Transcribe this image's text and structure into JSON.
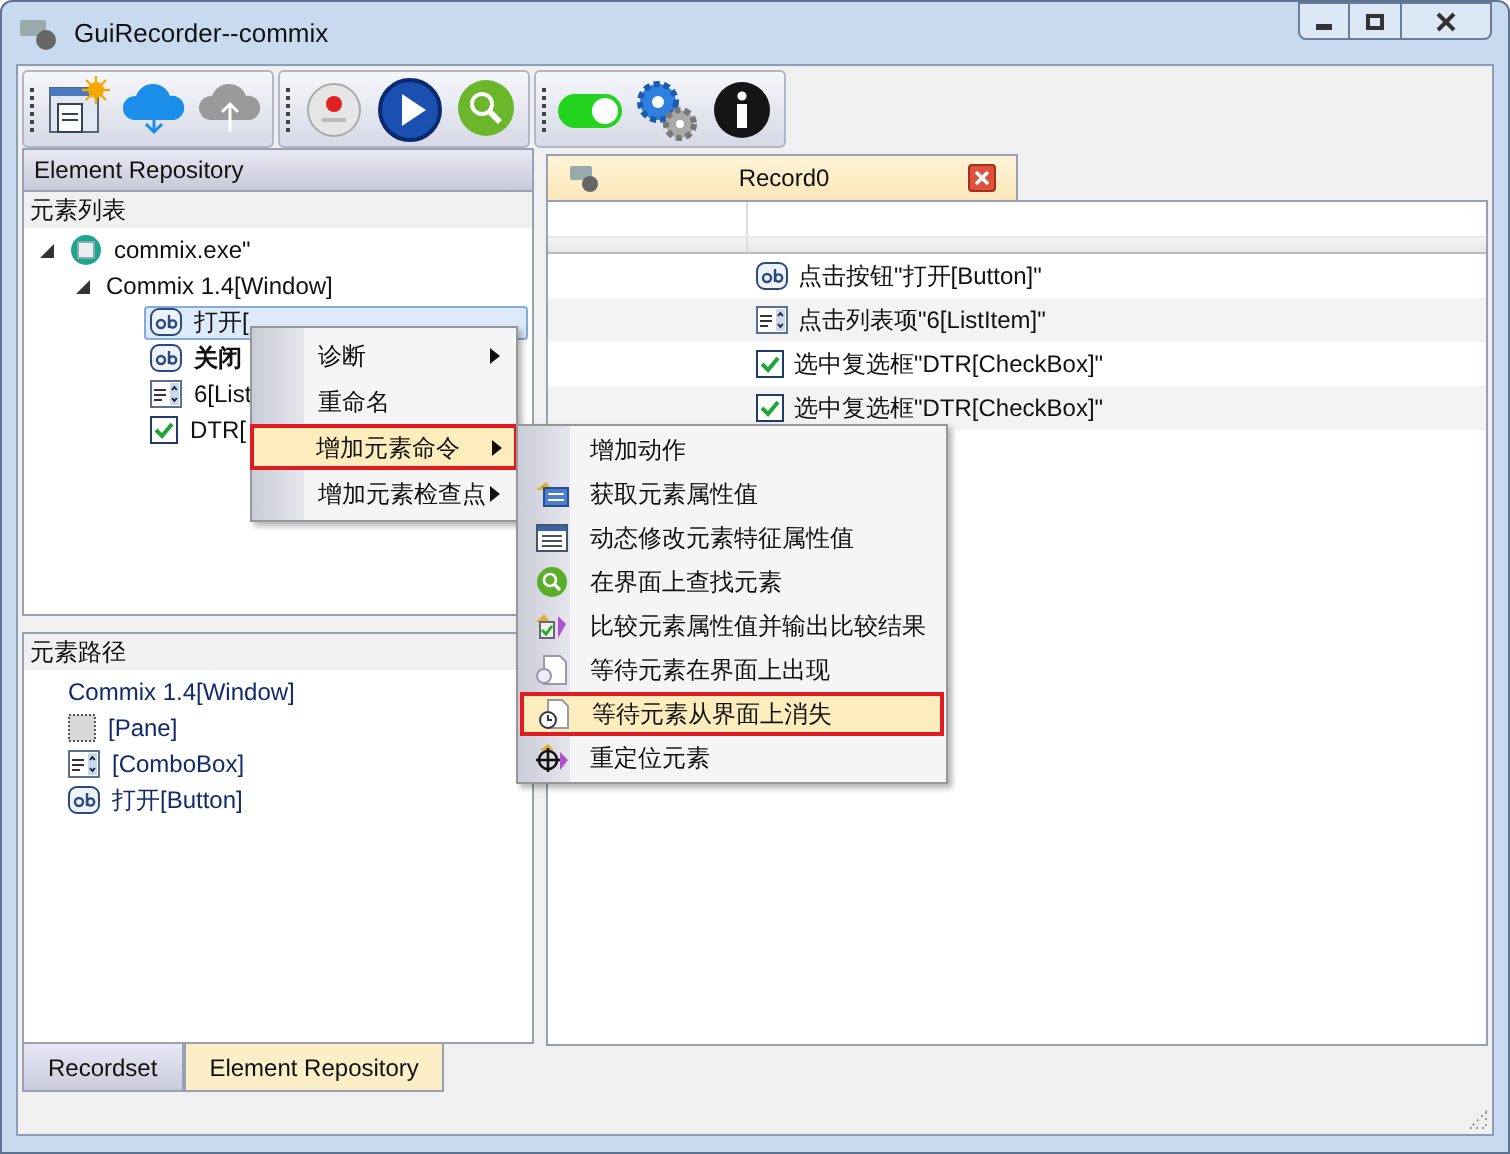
{
  "window": {
    "title": "GuiRecorder--commix"
  },
  "toolbar": [
    [
      {
        "kind": "new-window",
        "disabled": false
      },
      {
        "kind": "download",
        "disabled": false
      },
      {
        "kind": "upload",
        "disabled": true
      }
    ],
    [
      {
        "kind": "record",
        "disabled": false
      },
      {
        "kind": "play",
        "disabled": false
      },
      {
        "kind": "find",
        "disabled": false
      }
    ],
    [
      {
        "kind": "toggle",
        "disabled": false,
        "on": true
      },
      {
        "kind": "settings",
        "disabled": false
      },
      {
        "kind": "info",
        "disabled": false
      }
    ]
  ],
  "left_panel": {
    "title": "Element Repository",
    "element_list": {
      "header": "元素列表",
      "tree": [
        {
          "label": "commix.exe\"",
          "kind": "app",
          "expanded": true,
          "selected": false,
          "bold": false,
          "children": [
            {
              "label": "Commix 1.4[Window]",
              "expanded": true,
              "selected": false,
              "bold": false,
              "children": [
                {
                  "label": "打开[",
                  "kind": "button",
                  "selected": true,
                  "bold": false
                },
                {
                  "label": "关闭",
                  "kind": "button",
                  "selected": false,
                  "bold": true
                },
                {
                  "label": "6[List",
                  "kind": "list",
                  "selected": false,
                  "bold": false
                },
                {
                  "label": "DTR[",
                  "kind": "checkbox",
                  "selected": false,
                  "bold": false
                }
              ]
            }
          ]
        }
      ]
    },
    "element_path": {
      "header": "元素路径",
      "items": [
        {
          "label": "Commix 1.4[Window]"
        },
        {
          "label": "[Pane]",
          "kind": "pane"
        },
        {
          "label": "[ComboBox]",
          "kind": "combobox"
        },
        {
          "label": "打开[Button]",
          "kind": "button"
        }
      ]
    },
    "tabs": [
      {
        "label": "Recordset",
        "selected": false
      },
      {
        "label": "Element Repository",
        "selected": true
      }
    ]
  },
  "record_tab": {
    "title": "Record0",
    "rows": [
      {
        "kind": "button",
        "text": "点击按钮\"打开[Button]\""
      },
      {
        "kind": "list",
        "text": "点击列表项\"6[ListItem]\""
      },
      {
        "kind": "checkbox",
        "text": "选中复选框\"DTR[CheckBox]\""
      },
      {
        "kind": "checkbox",
        "text": "选中复选框\"DTR[CheckBox]\""
      }
    ]
  },
  "context_menu": [
    {
      "label": "诊断",
      "submenu": true,
      "selected": false
    },
    {
      "label": "重命名",
      "submenu": false,
      "selected": false
    },
    {
      "label": "增加元素命令",
      "submenu": true,
      "selected": true
    },
    {
      "label": "增加元素检查点",
      "submenu": true,
      "selected": false
    }
  ],
  "submenu": [
    {
      "label": "增加动作",
      "selected": false
    },
    {
      "label": "获取元素属性值",
      "kind": "get-property",
      "selected": false
    },
    {
      "label": "动态修改元素特征属性值",
      "kind": "form",
      "selected": false
    },
    {
      "label": "在界面上查找元素",
      "kind": "find",
      "selected": false
    },
    {
      "label": "比较元素属性值并输出比较结果",
      "kind": "compare",
      "selected": false
    },
    {
      "label": "等待元素在界面上出现",
      "kind": "page",
      "selected": false
    },
    {
      "label": "等待元素从界面上消失",
      "kind": "timer-page",
      "selected": true
    },
    {
      "label": "重定位元素",
      "kind": "crosshair",
      "selected": false
    }
  ]
}
